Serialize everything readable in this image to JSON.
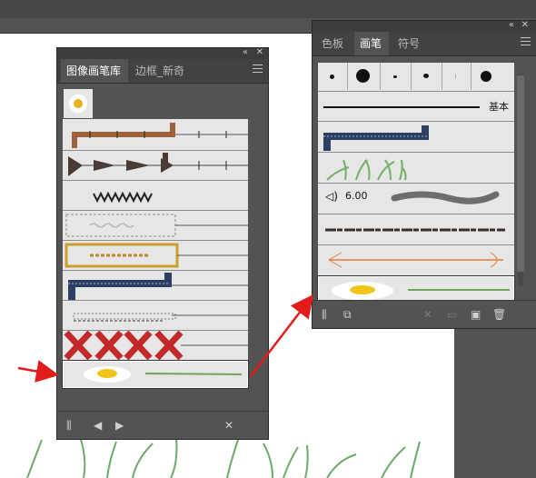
{
  "left_panel": {
    "controls": {
      "collapse": "«",
      "close": "✕"
    },
    "tabs": [
      {
        "label": "图像画笔库",
        "active": true
      },
      {
        "label": "边框_新奇",
        "active": false
      }
    ],
    "footer": {
      "library": "⫼",
      "prev": "◀",
      "next": "▶",
      "tool": "✕"
    }
  },
  "right_panel": {
    "controls": {
      "collapse": "«",
      "close": "✕"
    },
    "tabs": [
      {
        "label": "色板",
        "active": false
      },
      {
        "label": "画笔",
        "active": true
      },
      {
        "label": "符号",
        "active": false
      }
    ],
    "basic_label": "基本",
    "brush_size": "6.00",
    "footer": {
      "library": "⫼",
      "options": "⧉",
      "remove": "✕",
      "new_doc": "▭",
      "new": "▣",
      "delete": "🗑"
    }
  },
  "colors": {
    "arrow": "#e01c1c",
    "panel_bg": "#535353",
    "list_bg": "#e6e6e6",
    "selection": "#ffffff"
  }
}
